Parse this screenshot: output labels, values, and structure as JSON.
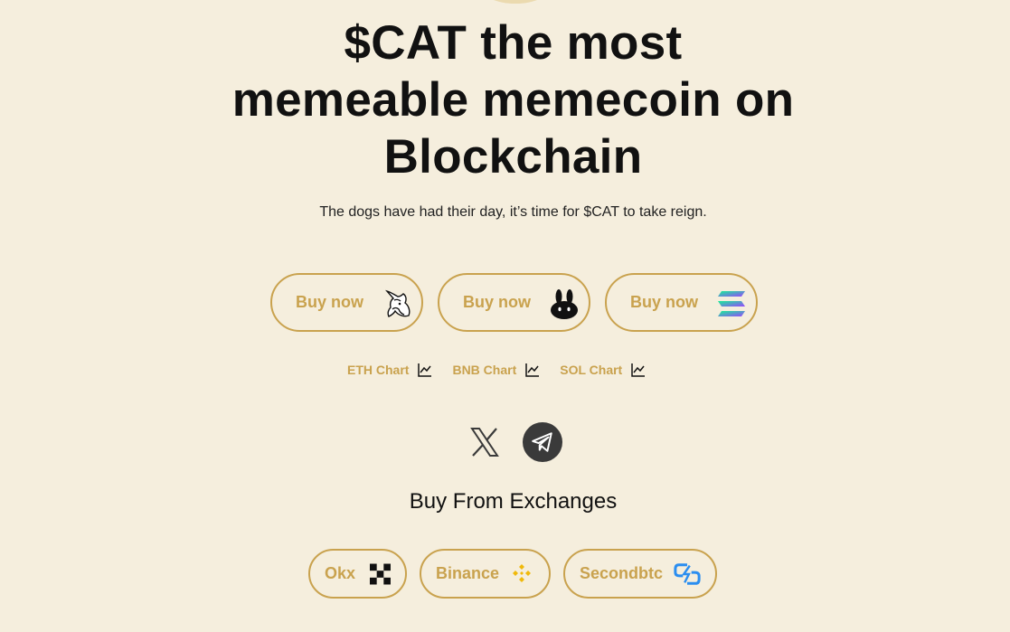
{
  "hero": {
    "line1": "$CAT the most",
    "line2": "memeable memecoin on",
    "line3": "Blockchain",
    "subtitle": "The dogs have had their day, it’s time for $CAT to take reign."
  },
  "buy_buttons": [
    {
      "label": "Buy now",
      "icon": "uniswap-icon"
    },
    {
      "label": "Buy now",
      "icon": "pancakeswap-icon"
    },
    {
      "label": "Buy now",
      "icon": "solana-icon"
    }
  ],
  "chart_links": [
    {
      "label": "ETH Chart",
      "icon": "chart-icon"
    },
    {
      "label": "BNB Chart",
      "icon": "chart-icon"
    },
    {
      "label": "SOL Chart",
      "icon": "chart-icon"
    }
  ],
  "social": {
    "x_icon": "x-icon",
    "telegram_icon": "telegram-icon"
  },
  "exchanges": {
    "title": "Buy From Exchanges",
    "items": [
      {
        "label": "Okx",
        "icon": "okx-icon"
      },
      {
        "label": "Binance",
        "icon": "binance-icon"
      },
      {
        "label": "Secondbtc",
        "icon": "secondbtc-icon"
      }
    ]
  },
  "colors": {
    "background": "#f5eedd",
    "accent": "#c9a24e",
    "text": "#111111"
  }
}
